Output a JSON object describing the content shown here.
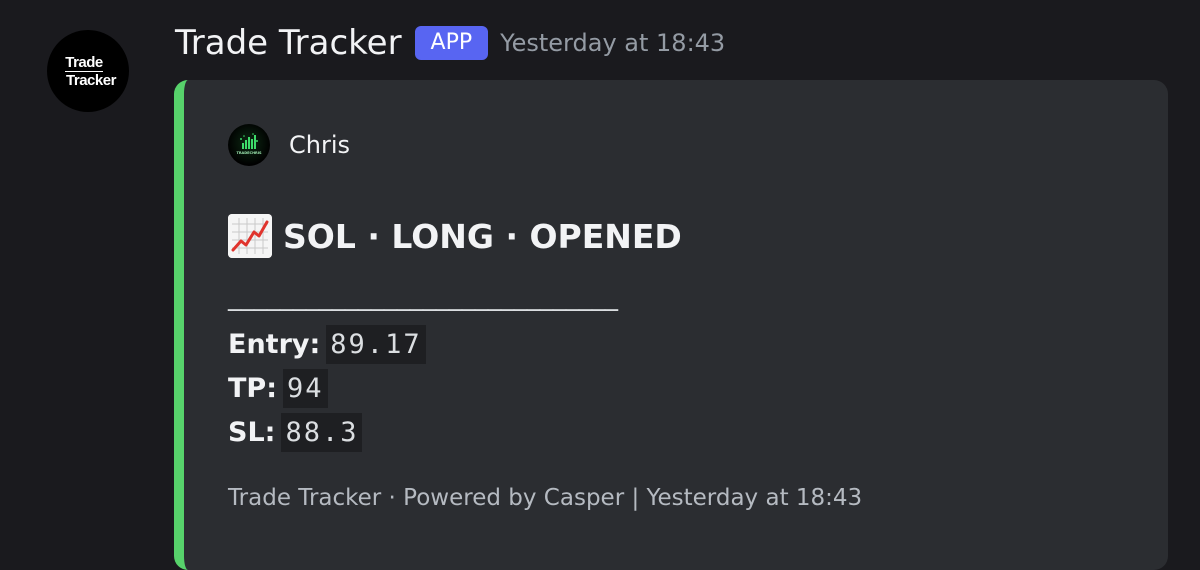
{
  "bot": {
    "avatar_text_line1": "Trade",
    "avatar_text_line2": "Tracker",
    "name": "Trade Tracker",
    "badge": "APP",
    "timestamp": "Yesterday at 18:43"
  },
  "embed": {
    "accent_color": "#57d26b",
    "author": {
      "name": "Chris",
      "avatar_text": "TRADECHRIS"
    },
    "title": {
      "icon": "chart-increasing-icon",
      "text": "SOL · LONG · OPENED"
    },
    "divider": "______________________________",
    "fields": [
      {
        "label": "Entry:",
        "value": "89.17"
      },
      {
        "label": "TP:",
        "value": "94"
      },
      {
        "label": "SL:",
        "value": "88.3"
      }
    ],
    "footer": "Trade Tracker · Powered by Casper | Yesterday at 18:43"
  }
}
